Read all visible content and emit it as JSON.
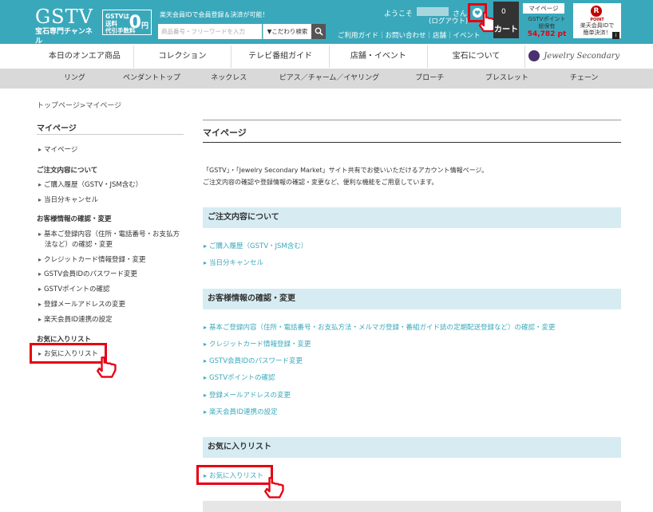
{
  "header": {
    "logo": "GSTV",
    "logo_sub": "宝石専門チャンネル",
    "promo_line1": "GSTVは",
    "promo_line2": "送料",
    "promo_line3": "代引手数料",
    "promo_zero": "0",
    "promo_unit": "円",
    "message": "楽天会員IDで会員登録＆決済が可能！",
    "search_placeholder": "商品番号・フリーワードを入力",
    "search_option": "▼こだわり検索",
    "welcome": "ようこそ",
    "san": "さん",
    "logout": "(ログアウト)",
    "top_links": "ご利用ガイド｜お問い合わせ｜店舗｜イベント",
    "cart_count": "0",
    "cart_label": "カート",
    "mypage": "マイページ",
    "points_label_1": "GSTVポイント",
    "points_label_2": "総保有",
    "points_value": "54,782 pt",
    "rakuten_point": "POINT",
    "rakuten_text_1": "楽天会員IDで",
    "rakuten_text_2": "簡単決済！",
    "rakuten_badge": "R",
    "corner": "i"
  },
  "main_nav": [
    "本日のオンエア商品",
    "コレクション",
    "テレビ番組ガイド",
    "店舗・イベント",
    "宝石について",
    "Jewelry Secondary Market"
  ],
  "categories": [
    "リング",
    "ペンダントトップ",
    "ネックレス",
    "ピアス／チャーム／イヤリング",
    "ブローチ",
    "ブレスレット",
    "チェーン"
  ],
  "breadcrumb": "トップページ>マイページ",
  "sidebar": {
    "title": "マイページ",
    "mypage": "マイページ",
    "order_head": "ご注文内容について",
    "order_history": "ご購入履歴（GSTV・JSM含む）",
    "cancel": "当日分キャンセル",
    "customer_head": "お客様情報の確認・変更",
    "basic_1": "基本ご登録内容（住所・電話番号・お支払方",
    "basic_2": "法など）の確認・変更",
    "credit": "クレジットカード情報登録・変更",
    "password": "GSTV会員IDのパスワード変更",
    "points": "GSTVポイントの確認",
    "email": "登録メールアドレスの変更",
    "rakuten": "楽天会員ID連携の設定",
    "fav_head": "お気に入りリスト",
    "fav": "お気に入りリスト"
  },
  "content": {
    "title": "マイページ",
    "desc_1": "「GSTV」・「Jewelry Secondary Market」サイト共有でお使いいただけるアカウント情報ページ。",
    "desc_2": "ご注文内容の確認や登録情報の確認・変更など、便利な機能をご用意しています。",
    "sections": [
      {
        "title": "ご注文内容について",
        "links": [
          "ご購入履歴（GSTV・JSM含む）",
          "当日分キャンセル"
        ]
      },
      {
        "title": "お客様情報の確認・変更",
        "links": [
          "基本ご登録内容（住所・電話番号・お支払方法・メルマガ登録・番組ガイド誌の定期配送登録など）の確認・変更",
          "クレジットカード情報登録・変更",
          "GSTV会員IDのパスワード変更",
          "GSTVポイントの確認",
          "登録メールアドレスの変更",
          "楽天会員ID連携の設定"
        ]
      },
      {
        "title": "お気に入りリスト",
        "links": [
          "お気に入りリスト"
        ]
      }
    ]
  },
  "colors": {
    "header": "#3aa8bb",
    "highlight": "#e60012",
    "link": "#3aa8bb",
    "section_bg": "#d6ecf2",
    "category_bg": "#d9d9d9"
  }
}
